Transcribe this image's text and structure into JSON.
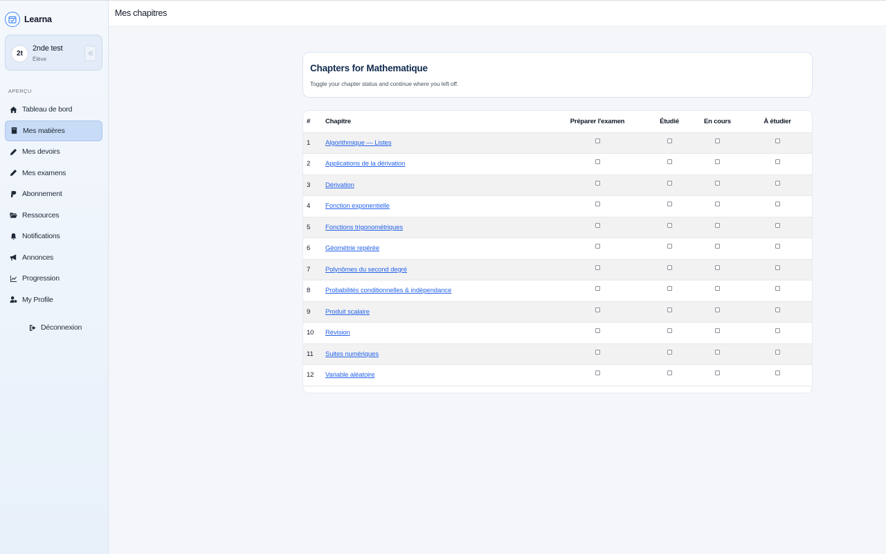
{
  "brand": {
    "name": "Learna",
    "logo_icon": "calendar-check-icon"
  },
  "user": {
    "initials": "2t",
    "name": "2nde test",
    "role": "Élève"
  },
  "sidebar": {
    "section_label": "APERÇU",
    "items": [
      {
        "label": "Tableau de bord",
        "icon": "home-icon"
      },
      {
        "label": "Mes matières",
        "icon": "book-icon",
        "active": true
      },
      {
        "label": "Mes devoirs",
        "icon": "pencil-icon"
      },
      {
        "label": "Mes examens",
        "icon": "pencil-icon"
      },
      {
        "label": "Abonnement",
        "icon": "paypal-icon"
      },
      {
        "label": "Ressources",
        "icon": "folder-icon"
      },
      {
        "label": "Notifications",
        "icon": "bell-icon"
      },
      {
        "label": "Annonces",
        "icon": "megaphone-icon"
      },
      {
        "label": "Progression",
        "icon": "chart-line-icon"
      },
      {
        "label": "My Profile",
        "icon": "user-gear-icon"
      }
    ],
    "logout_label": "Déconnexion"
  },
  "topbar": {
    "title": "Mes chapitres"
  },
  "header": {
    "title": "Chapters for Mathematique",
    "subtitle": "Toggle your chapter status and continue where you left off."
  },
  "table": {
    "columns": [
      "#",
      "Chapitre",
      "Préparer l'examen",
      "Étudié",
      "En cours",
      "À étudier"
    ],
    "rows": [
      {
        "num": "1",
        "name": "Algorithmique — Listes"
      },
      {
        "num": "2",
        "name": "Applications de la dérivation"
      },
      {
        "num": "3",
        "name": "Dérivation"
      },
      {
        "num": "4",
        "name": "Fonction exponentielle"
      },
      {
        "num": "5",
        "name": "Fonctions trigonométriques"
      },
      {
        "num": "6",
        "name": "Géométrie repérée"
      },
      {
        "num": "7",
        "name": "Polynômes du second degré"
      },
      {
        "num": "8",
        "name": "Probabilités conditionnelles & indépendance"
      },
      {
        "num": "9",
        "name": "Produit scalaire"
      },
      {
        "num": "10",
        "name": "Révision"
      },
      {
        "num": "11",
        "name": "Suites numériques"
      },
      {
        "num": "12",
        "name": "Variable aléatoire"
      }
    ]
  },
  "colors": {
    "accent": "#2563eb",
    "active_nav": "#c9dcf7",
    "title": "#0f2a4d"
  }
}
